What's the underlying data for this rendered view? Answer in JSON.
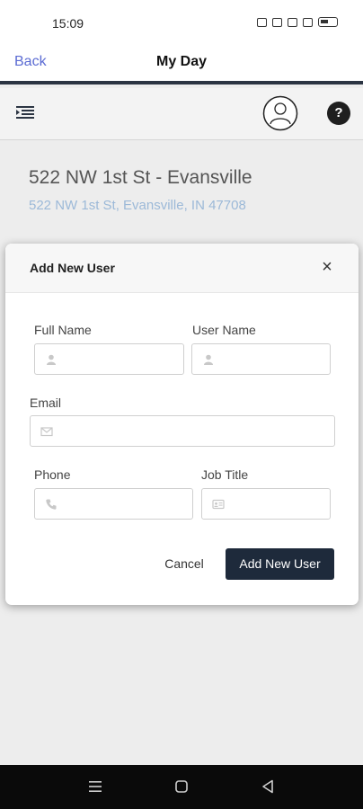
{
  "status_bar": {
    "time": "15:09"
  },
  "nav": {
    "back_label": "Back",
    "title": "My Day"
  },
  "toolbar": {
    "help_label": "?"
  },
  "property": {
    "title": "522 NW 1st St - Evansville",
    "address": "522 NW 1st St, Evansville, IN 47708"
  },
  "modal": {
    "title": "Add New User",
    "fields": {
      "full_name": {
        "label": "Full Name",
        "value": ""
      },
      "user_name": {
        "label": "User Name",
        "value": ""
      },
      "email": {
        "label": "Email",
        "value": ""
      },
      "phone": {
        "label": "Phone",
        "value": ""
      },
      "job_title": {
        "label": "Job Title",
        "value": ""
      }
    },
    "cancel_label": "Cancel",
    "submit_label": "Add New User"
  },
  "colors": {
    "accent_link": "#5b6bd3",
    "address_link": "#9cb9d8",
    "primary_button": "#1e2a3b",
    "nav_border": "#2b3442"
  },
  "icons": [
    "menu-icon",
    "user-avatar-icon",
    "help-icon",
    "close-icon",
    "person-icon",
    "mail-icon",
    "phone-icon",
    "id-card-icon"
  ]
}
